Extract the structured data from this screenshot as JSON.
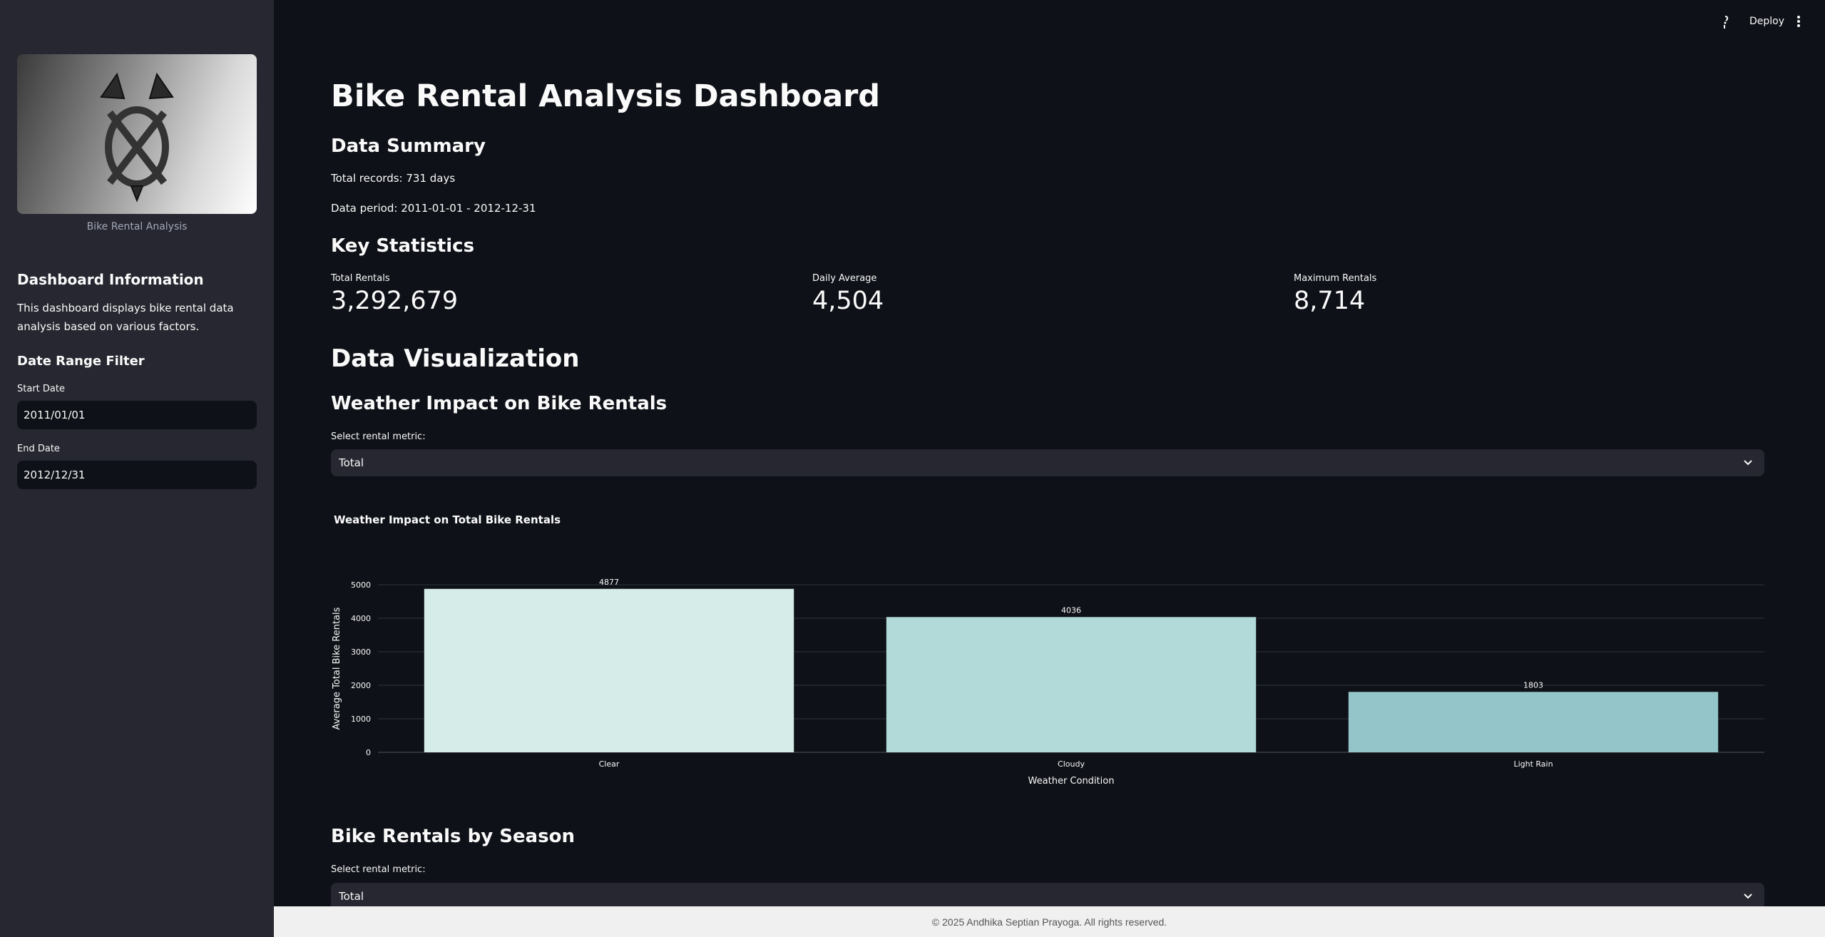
{
  "header": {
    "deploy_label": "Deploy"
  },
  "sidebar": {
    "logo_caption": "Bike Rental Analysis",
    "info_title": "Dashboard Information",
    "info_text": "This dashboard displays bike rental data analysis based on various factors.",
    "filter_title": "Date Range Filter",
    "start_label": "Start Date",
    "start_value": "2011/01/01",
    "end_label": "End Date",
    "end_value": "2012/12/31"
  },
  "main": {
    "title": "Bike Rental Analysis Dashboard",
    "summary_title": "Data Summary",
    "total_records": "Total records: 731 days",
    "data_period": "Data period: 2011-01-01 - 2012-12-31",
    "stats_title": "Key Statistics",
    "metrics": [
      {
        "label": "Total Rentals",
        "value": "3,292,679"
      },
      {
        "label": "Daily Average",
        "value": "4,504"
      },
      {
        "label": "Maximum Rentals",
        "value": "8,714"
      }
    ],
    "viz_title": "Data Visualization",
    "weather_title": "Weather Impact on Bike Rentals",
    "weather_select_label": "Select rental metric:",
    "weather_select_value": "Total",
    "season_title": "Bike Rentals by Season",
    "season_select_label": "Select rental metric:",
    "season_select_value": "Total"
  },
  "chart_data": {
    "type": "bar",
    "title": "Weather Impact on Total Bike Rentals",
    "xlabel": "Weather Condition",
    "ylabel": "Average Total Bike Rentals",
    "categories": [
      "Clear",
      "Cloudy",
      "Light Rain"
    ],
    "values": [
      4877,
      4036,
      1803
    ],
    "ylim": [
      0,
      5000
    ],
    "yticks": [
      0,
      1000,
      2000,
      3000,
      4000,
      5000
    ],
    "colors": [
      "#d6ece9",
      "#b1dad8",
      "#93c5c9"
    ],
    "grid": true
  },
  "footer": {
    "text": "© 2025 Andhika Septian Prayoga. All rights reserved."
  }
}
